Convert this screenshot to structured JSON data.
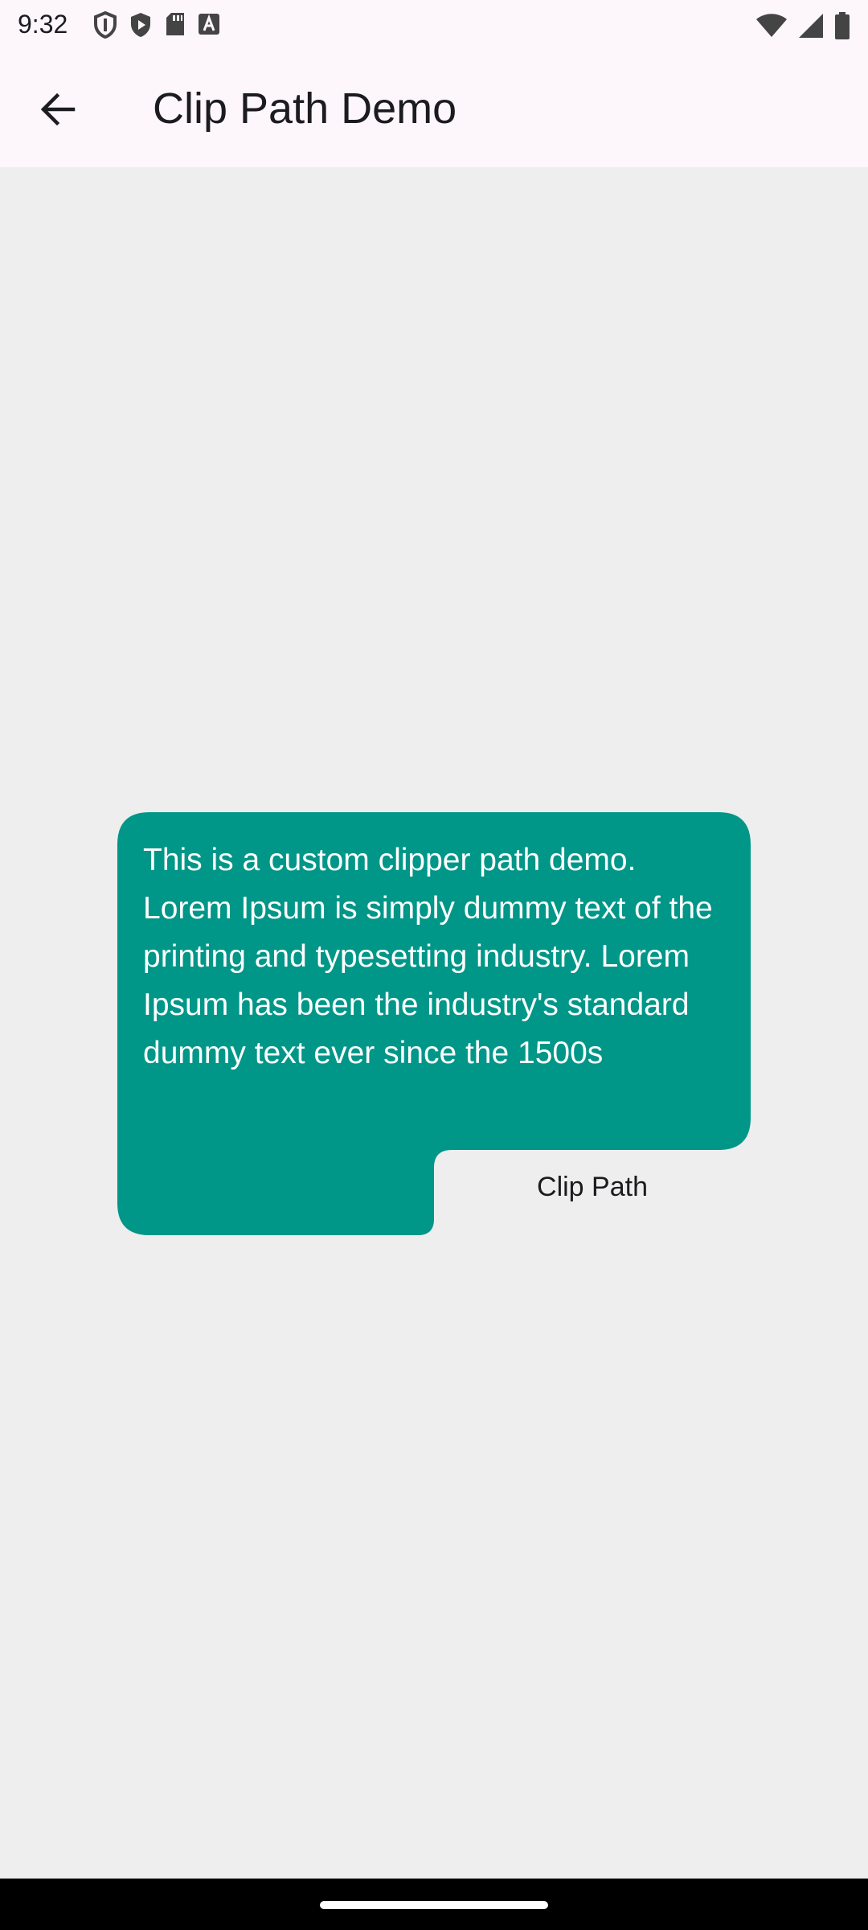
{
  "status_bar": {
    "time": "9:32",
    "left_icons": [
      "shield-outline-icon",
      "shield-play-icon",
      "sd-card-icon",
      "font-a-icon"
    ],
    "right_icons": [
      "wifi-icon",
      "signal-icon",
      "battery-icon"
    ]
  },
  "app_bar": {
    "title": "Clip Path Demo",
    "back_icon": "arrow-back-icon"
  },
  "card": {
    "text": "This is a custom clipper path demo. Lorem Ipsum is simply dummy text of the printing and typesetting industry. Lorem Ipsum has been the industry's standard dummy text ever since the 1500s",
    "button_label": "Clip Path",
    "color": "#009688"
  },
  "colors": {
    "background": "#eeeeee",
    "app_bar": "#fdf7fb",
    "text_dark": "#1c1b1f"
  }
}
